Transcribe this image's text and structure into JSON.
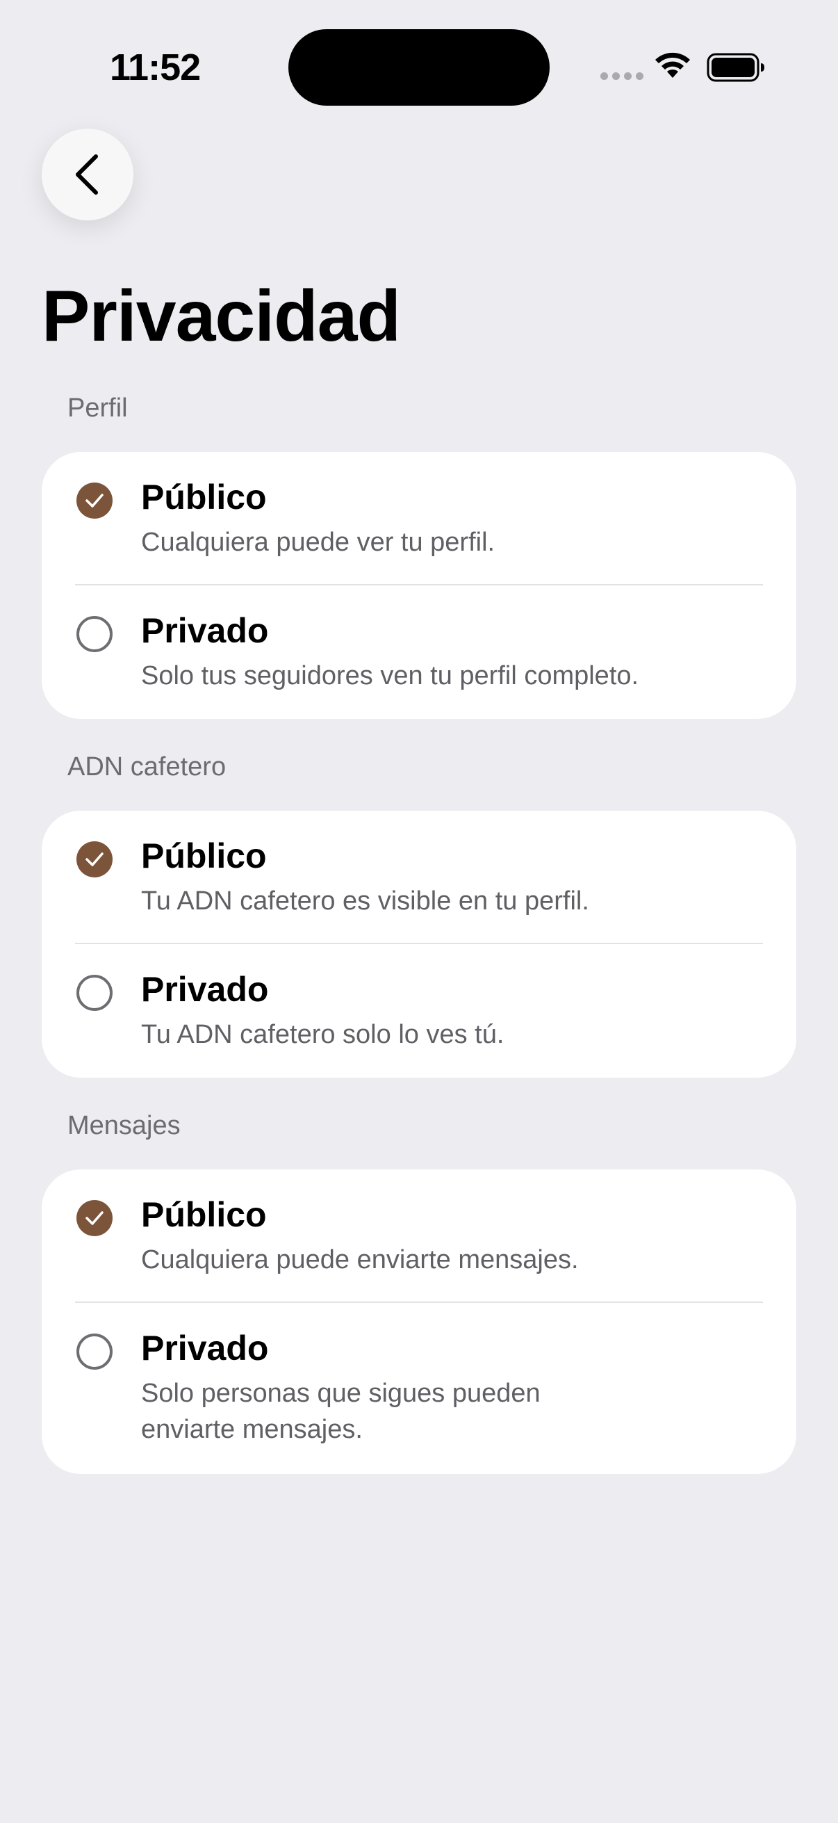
{
  "status_bar": {
    "time": "11:52",
    "icons": [
      "cellular-dots-icon",
      "wifi-icon",
      "battery-icon"
    ]
  },
  "nav": {
    "back_icon": "chevron-left-icon"
  },
  "title": "Privacidad",
  "accent_color": "#7b543a",
  "sections": [
    {
      "header": "Perfil",
      "options": [
        {
          "title": "Público",
          "description": "Cualquiera puede ver tu perfil.",
          "selected": true
        },
        {
          "title": "Privado",
          "description": "Solo tus seguidores ven tu perfil completo.",
          "selected": false
        }
      ]
    },
    {
      "header": "ADN cafetero",
      "options": [
        {
          "title": "Público",
          "description": "Tu ADN cafetero es visible en tu perfil.",
          "selected": true
        },
        {
          "title": "Privado",
          "description": "Tu ADN cafetero solo lo ves tú.",
          "selected": false
        }
      ]
    },
    {
      "header": "Mensajes",
      "options": [
        {
          "title": "Público",
          "description": "Cualquiera puede enviarte mensajes.",
          "selected": true
        },
        {
          "title": "Privado",
          "description": "Solo personas que sigues pueden enviarte mensajes.",
          "selected": false
        }
      ]
    }
  ]
}
